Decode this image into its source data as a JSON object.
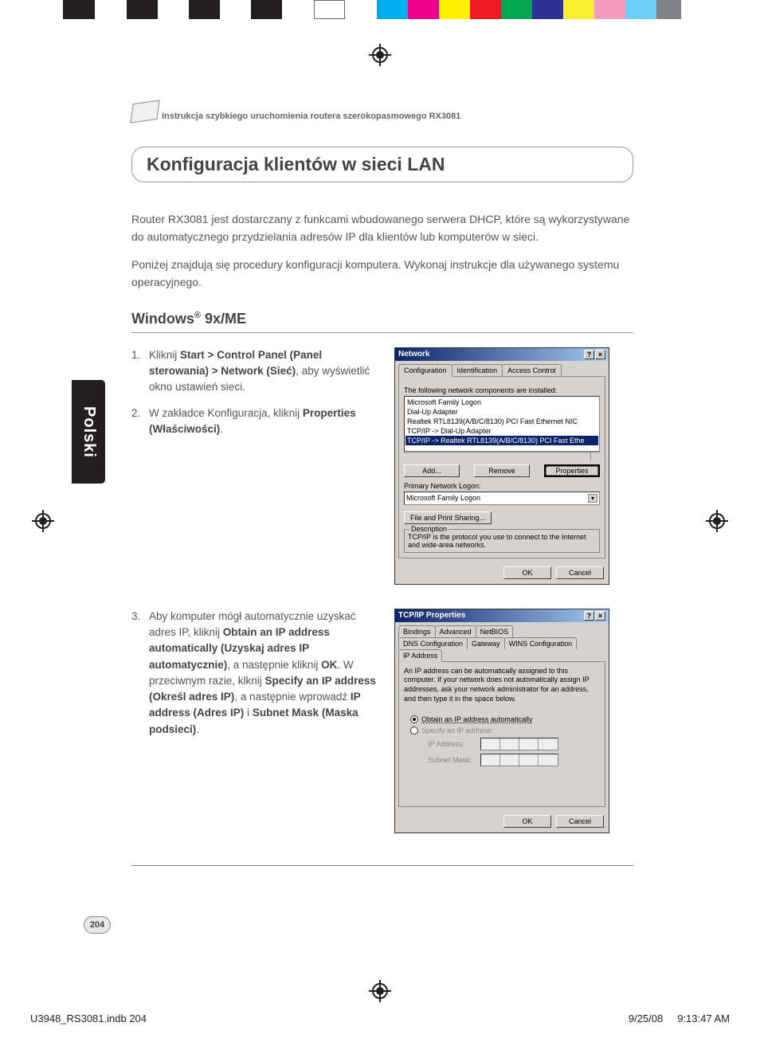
{
  "header": {
    "running_head": "Instrukcja szybkiego uruchomienia routera szerokopasmowego RX3081"
  },
  "section": {
    "title": "Konfiguracja klientów w sieci LAN",
    "para1": "Router RX3081 jest dostarczany z funkcami wbudowanego serwera DHCP, które są wykorzystywane do automatycznego przydzielania adresów IP dla klientów lub komputerów w sieci.",
    "para2": "Poniżej znajdują się procedury konfiguracji komputera. Wykonaj instrukcje dla używanego systemu operacyjnego."
  },
  "subhead": "Windows® 9x/ME",
  "lang_tab": "Polski",
  "steps_a": {
    "1": {
      "num": "1.",
      "pre": "Kliknij ",
      "bold": "Start > Control Panel (Panel sterowania) > Network (Sieć)",
      "post": ", aby wyświetlić okno ustawień sieci."
    },
    "2": {
      "num": "2.",
      "pre": "W zakładce Konfiguracja, kliknij ",
      "bold": "Properties (Właściwości)",
      "post": "."
    }
  },
  "steps_b": {
    "3": {
      "num": "3.",
      "t1": "Aby komputer mógł automatycznie uzyskać adres IP, kliknij ",
      "b1": "Obtain an IP address automatically (Uzyskaj adres IP automatycznie)",
      "t2": ", a następnie kliknij ",
      "b2": "OK",
      "t3": ". W przeciwnym razie, klknij ",
      "b3": "Specify an IP address (Określ adres IP)",
      "t4": ", a następnie wprowadź ",
      "b4": "IP address (Adres IP)",
      "t5": " i ",
      "b5": "Subnet Mask (Maska podsieci)",
      "t6": "."
    }
  },
  "dialog1": {
    "title": "Network",
    "help": "?",
    "close": "×",
    "tabs": [
      "Configuration",
      "Identification",
      "Access Control"
    ],
    "list_label": "The following network components are installed:",
    "list": [
      "Microsoft Family Logon",
      "Dial-Up Adapter",
      "Realtek RTL8139(A/B/C/8130) PCI Fast Ethernet NIC",
      "TCP/IP -> Dial-Up Adapter",
      "TCP/IP -> Realtek RTL8139(A/B/C/8130) PCI Fast Ethe"
    ],
    "btn_add": "Add...",
    "btn_remove": "Remove",
    "btn_props": "Properties",
    "primary_label": "Primary Network Logon:",
    "primary_value": "Microsoft Family Logon",
    "file_share": "File and Print Sharing...",
    "desc_label": "Description",
    "desc_text": "TCP/IP is the protocol you use to connect to the Internet and wide-area networks.",
    "ok": "OK",
    "cancel": "Cancel"
  },
  "dialog2": {
    "title": "TCP/IP Properties",
    "help": "?",
    "close": "×",
    "tabs_row1": [
      "Bindings",
      "Advanced",
      "NetBIOS"
    ],
    "tabs_row2": [
      "DNS Configuration",
      "Gateway",
      "WINS Configuration",
      "IP Address"
    ],
    "info": "An IP address can be automatically assigned to this computer. If your network does not automatically assign IP addresses, ask your network administrator for an address, and then type it in the space below.",
    "radio_auto": "Obtain an IP address automatically",
    "radio_spec": "Specify an IP address:",
    "ip_label": "IP Address:",
    "subnet_label": "Subnet Mask:",
    "ok": "OK",
    "cancel": "Cancel"
  },
  "page_number": "204",
  "footer": {
    "file": "U3948_RS3081.indb   204",
    "date": "9/25/08",
    "time": "9:13:47 AM"
  }
}
